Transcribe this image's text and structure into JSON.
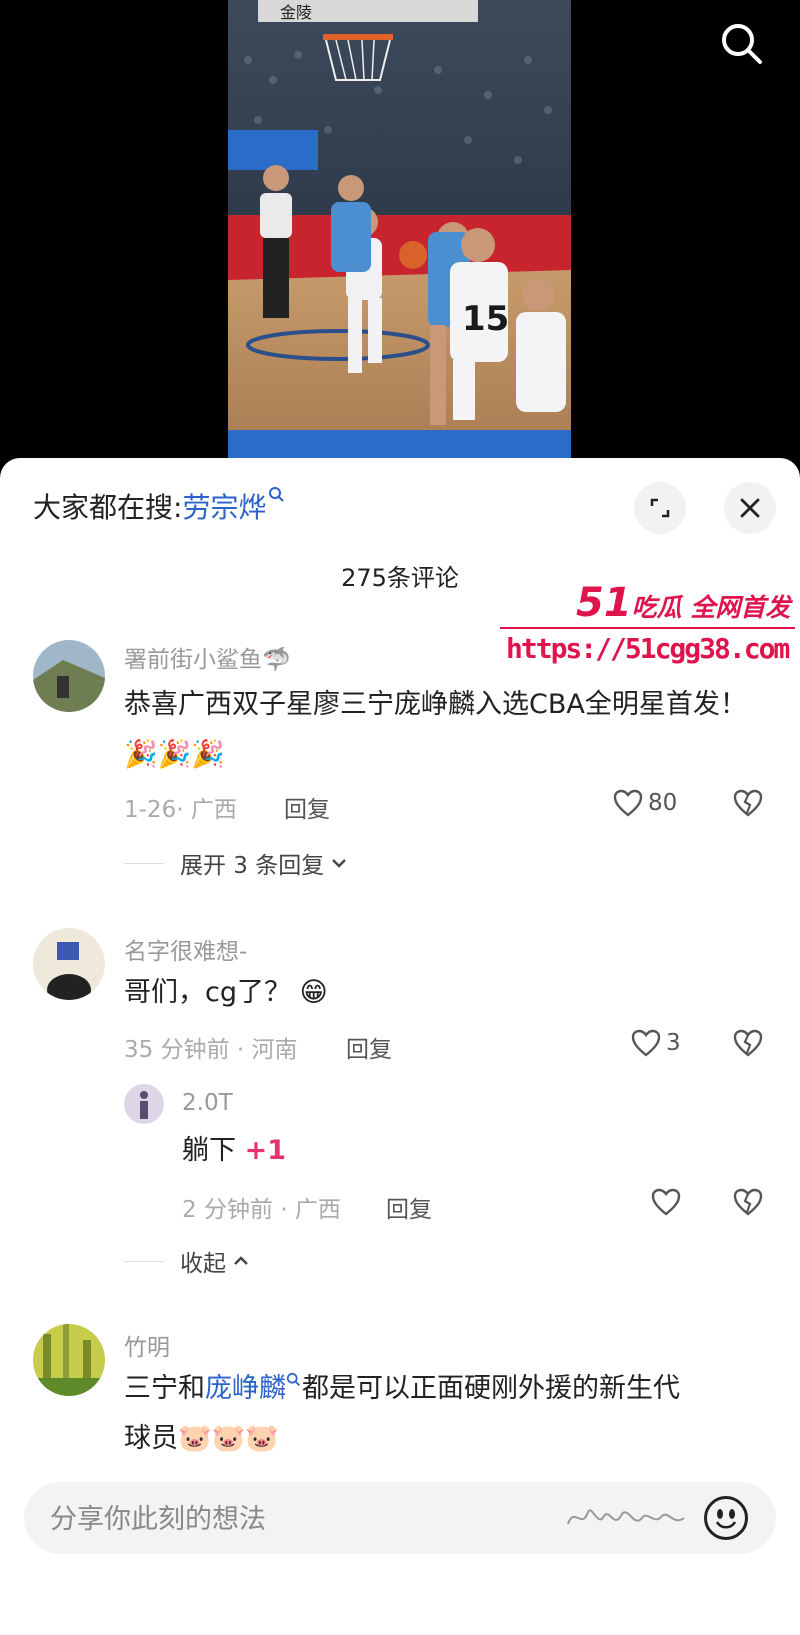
{
  "header": {
    "trending_prefix": "大家都在搜:",
    "trending_term": "劳宗烨",
    "comment_count": "275条评论"
  },
  "video": {
    "scoreboard_text": "金陵",
    "jersey_number": "15"
  },
  "watermark": {
    "title_number": "51",
    "title_text": "吃瓜 全网首发",
    "url": "https://51cgg38.com"
  },
  "comments": [
    {
      "username": "署前街小鲨鱼",
      "emoji": "🦈",
      "text": "恭喜广西双子星廖三宁庞峥麟入选CBA全明星首发！",
      "emojis": "🎉🎉🎉",
      "meta": "1-26· 广西",
      "reply_label": "回复",
      "likes": "80",
      "expand_label": "展开 3 条回复"
    },
    {
      "username": "名字很难想-",
      "text": "哥们，cg了？",
      "emojis": "😁",
      "meta": "35 分钟前 · 河南",
      "reply_label": "回复",
      "likes": "3",
      "replies": [
        {
          "username": "2.0T",
          "text": "躺下",
          "plus": "+1",
          "meta": "2 分钟前 · 广西",
          "reply_label": "回复"
        }
      ],
      "collapse_label": "收起"
    },
    {
      "username": "竹明",
      "text_before": "三宁和",
      "text_link": "庞峥麟",
      "text_after": "都是可以正面硬刚外援的新生代",
      "text_line2": "球员",
      "emojis": "🐷🐷🐷"
    }
  ],
  "input": {
    "placeholder": "分享你此刻的想法"
  },
  "colors": {
    "accent_link": "#2b63c9",
    "watermark": "#e0144c",
    "plus_one": "#e8316d"
  }
}
